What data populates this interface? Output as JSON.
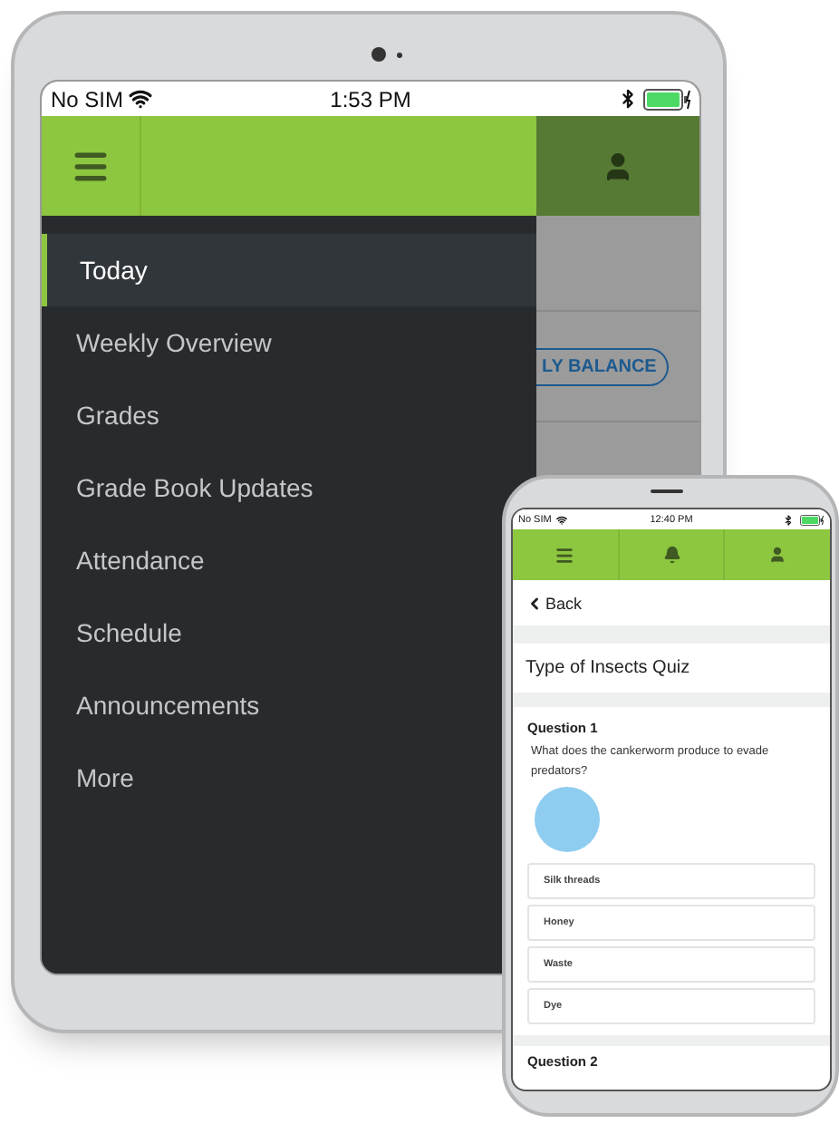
{
  "tablet": {
    "status_bar": {
      "carrier": "No SIM",
      "time": "1:53 PM"
    },
    "drawer": {
      "items": [
        {
          "label": "Today",
          "selected": true
        },
        {
          "label": "Weekly Overview",
          "selected": false
        },
        {
          "label": "Grades",
          "selected": false
        },
        {
          "label": "Grade Book Updates",
          "selected": false
        },
        {
          "label": "Attendance",
          "selected": false
        },
        {
          "label": "Schedule",
          "selected": false
        },
        {
          "label": "Announcements",
          "selected": false
        },
        {
          "label": "More",
          "selected": false
        }
      ]
    },
    "background_button": "LY BALANCE"
  },
  "phone": {
    "status_bar": {
      "carrier": "No SIM",
      "time": "12:40 PM"
    },
    "back": "Back",
    "quiz_title": "Type of Insects Quiz",
    "questions": [
      {
        "title": "Question 1",
        "text": "What does the cankerworm produce to evade predators?",
        "answers": [
          "Silk threads",
          "Honey",
          "Waste",
          "Dye"
        ]
      }
    ],
    "next_question_title": "Question 2"
  }
}
